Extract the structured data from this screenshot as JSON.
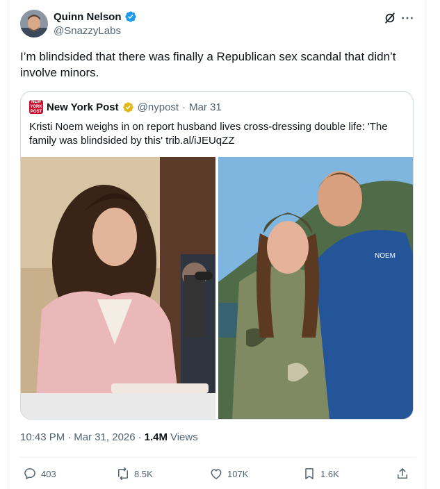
{
  "author": {
    "name": "Quinn Nelson",
    "handle": "@SnazzyLabs",
    "verified": true
  },
  "tweet": {
    "text": "I’m blindsided that there was finally a Republican sex scandal that didn’t involve minors."
  },
  "quote": {
    "logo_text": "NEW YORK POST",
    "name": "New York Post",
    "verified_color": "#e2b719",
    "handle": "@nypost",
    "separator": "·",
    "date": "Mar 31",
    "text": "Kristi Noem weighs in on report husband lives cross-dressing double life: 'The family was blindsided by this' trib.al/iJEUqZZ",
    "jacket_text": "NOEM"
  },
  "meta": {
    "time": "10:43 PM",
    "separator1": "·",
    "date": "Mar 31, 2026",
    "separator2": "·",
    "views_count": "1.4M",
    "views_label": "Views"
  },
  "actions": {
    "replies": "403",
    "reposts": "8.5K",
    "likes": "107K",
    "bookmarks": "1.6K"
  },
  "icons": {
    "verified": "verified-badge-icon",
    "grok": "grok-icon",
    "more": "more-dots-icon",
    "reply": "reply-icon",
    "repost": "repost-icon",
    "like": "heart-icon",
    "bookmark": "bookmark-icon",
    "share": "share-icon"
  },
  "colors": {
    "accent": "#1d9bf0",
    "text": "#0f1419",
    "muted": "#536471",
    "nypost_red": "#c8102e"
  }
}
